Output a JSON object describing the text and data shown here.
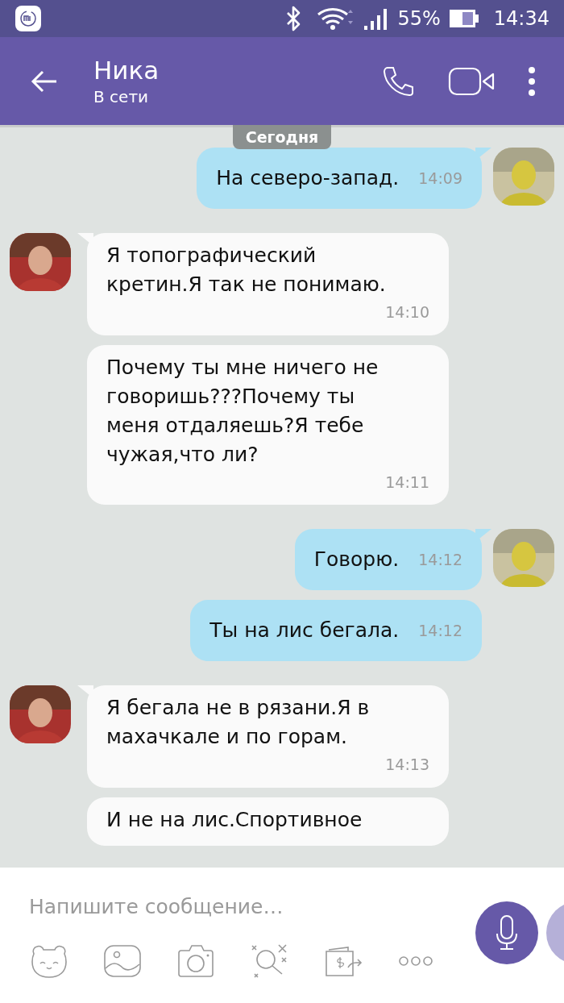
{
  "status_bar": {
    "battery": "55%",
    "time": "14:34"
  },
  "header": {
    "name": "Ника",
    "status": "В сети"
  },
  "date_label": "Сегодня",
  "messages": [
    {
      "kind": "out",
      "show_avatar": true,
      "lines": [
        "На северо-запад."
      ],
      "time": "14:09"
    },
    {
      "kind": "in",
      "show_avatar": true,
      "lines": [
        "Я топографический",
        "кретин.Я так не понимаю."
      ],
      "time": "14:10"
    },
    {
      "kind": "in",
      "show_avatar": false,
      "lines": [
        "Почему ты мне ничего не",
        "говоришь???Почему ты",
        "меня отдаляешь?Я тебе",
        "чужая,что ли?"
      ],
      "time": "14:11"
    },
    {
      "kind": "out",
      "show_avatar": true,
      "lines": [
        "Говорю."
      ],
      "time": "14:12"
    },
    {
      "kind": "out",
      "show_avatar": false,
      "lines": [
        "Ты на лис бегала."
      ],
      "time": "14:12"
    },
    {
      "kind": "in",
      "show_avatar": true,
      "lines": [
        "Я бегала не в рязани.Я в",
        "махачкале и по горам."
      ],
      "time": "14:13"
    },
    {
      "kind": "in",
      "show_avatar": false,
      "lines": [
        "И не на лис.Спортивное"
      ]
    }
  ],
  "composer": {
    "placeholder": "Напишите сообщение…"
  }
}
